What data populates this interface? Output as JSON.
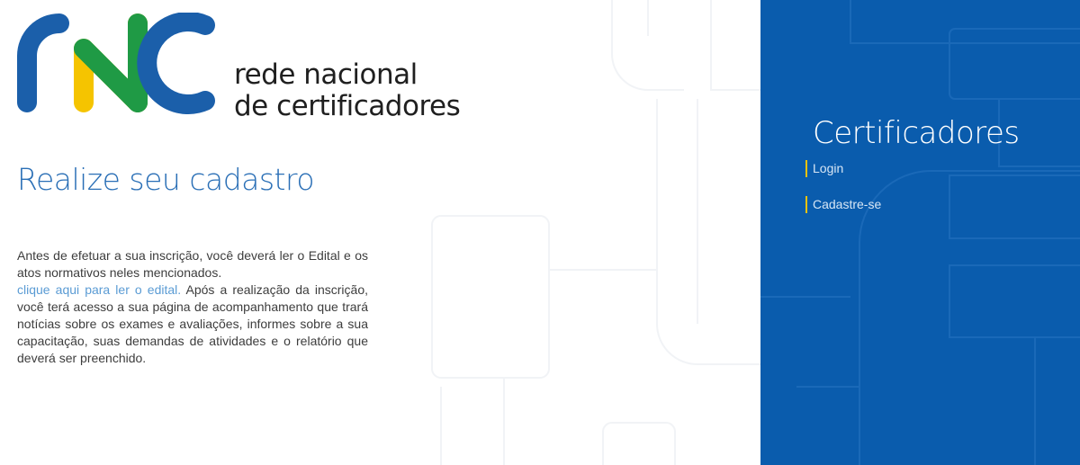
{
  "brand": {
    "line1": "rede nacional",
    "line2": "de certificadores",
    "colors": {
      "blue": "#1b5faa",
      "yellow": "#f5c400",
      "green": "#1f9a45"
    }
  },
  "main": {
    "heading": "Realize seu cadastro",
    "intro_text_1": "Antes de efetuar a sua inscrição, você deverá ler o Edital e os atos normativos neles mencionados.",
    "edital_link": "clique aqui para ler o edital.",
    "intro_text_2": " Após a realização da inscrição, você terá acesso a sua página de acompanhamento que trará notícias sobre os exames e avaliações, informes sobre a sua capacitação, suas demandas de atividades e o relatório que deverá ser preenchido."
  },
  "side_panel": {
    "title": "Certificadores",
    "menu": [
      {
        "label": "Login"
      },
      {
        "label": "Cadastre-se"
      }
    ],
    "accent": "#f2c200",
    "background": "#0a5cad"
  }
}
